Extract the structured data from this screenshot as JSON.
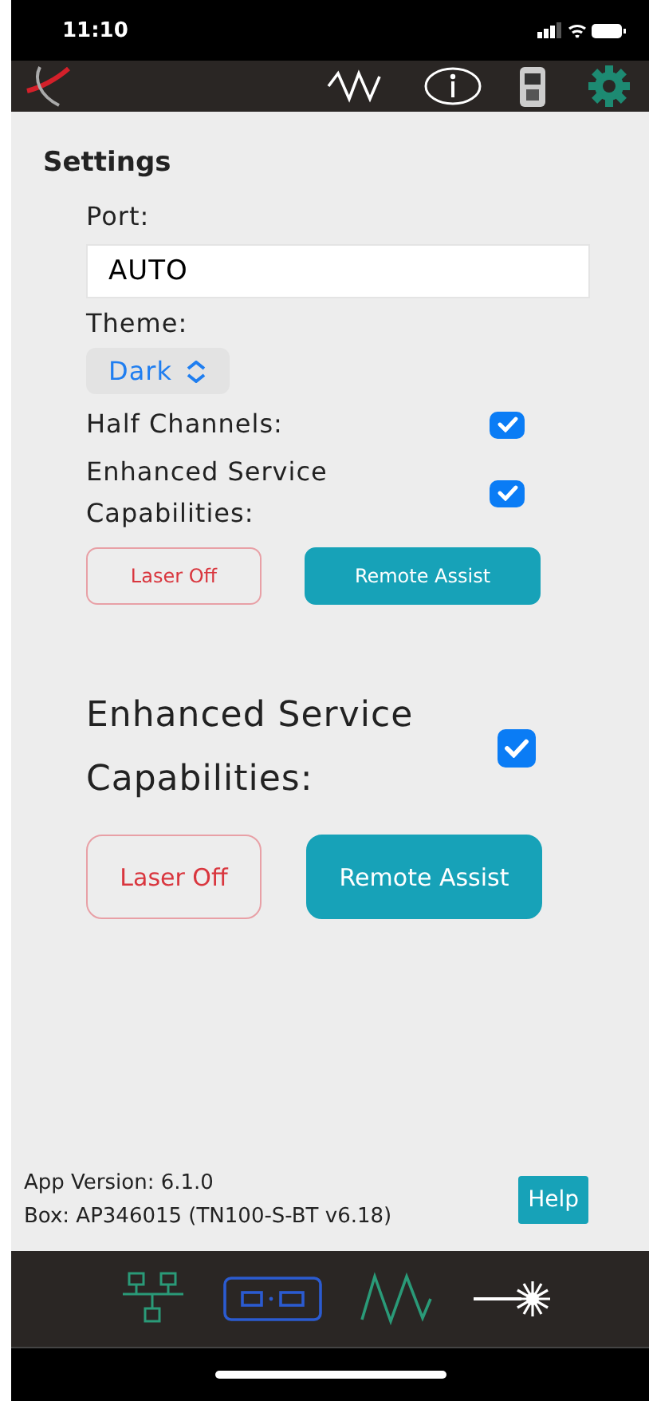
{
  "status_bar": {
    "time": "11:10"
  },
  "settings": {
    "title": "Settings",
    "port": {
      "label": "Port:",
      "value": "AUTO"
    },
    "theme": {
      "label": "Theme:",
      "value": "Dark"
    },
    "toggles": [
      {
        "label": "Half Channels:",
        "checked": true
      },
      {
        "label": "Enhanced Service Capabilities:",
        "checked": true
      }
    ],
    "buttons": [
      {
        "label": "Laser Off",
        "kind": "outline"
      },
      {
        "label": "Remote Assist",
        "kind": "filled"
      }
    ]
  },
  "large_section": {
    "toggle": {
      "label": "Enhanced Service Capabilities:",
      "checked": true
    },
    "buttons": [
      {
        "label": "Laser Off",
        "kind": "outline"
      },
      {
        "label": "Remote Assist",
        "kind": "filled"
      }
    ]
  },
  "footer": {
    "app_version": "App Version: 6.1.0",
    "box": "Box: AP346015 (TN100-S-BT v6.18)",
    "help": "Help"
  }
}
